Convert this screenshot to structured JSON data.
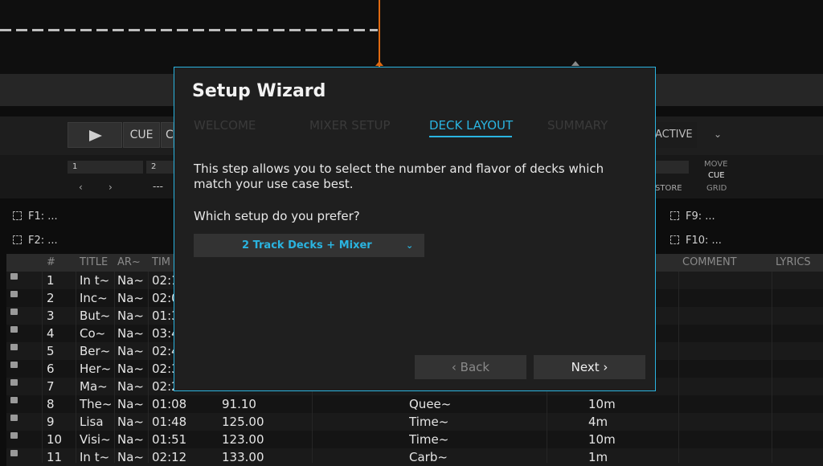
{
  "deck": {
    "cue_label": "CUE",
    "cue_b_label": "C",
    "active_label": "ACTIVE",
    "loop_cells": [
      "1",
      "2"
    ],
    "arrow_left": "‹",
    "arrow_right": "›",
    "dots": "---",
    "store_label": "STORE",
    "move_label": "MOVE",
    "cue_mode_label": "CUE",
    "grid_label": "GRID"
  },
  "favorites": [
    "F1: ...",
    "F2: ...",
    "F9: ...",
    "F10: ..."
  ],
  "table": {
    "headers": {
      "num": "#",
      "title": "TITLE",
      "artist": "AR~",
      "time": "TIM",
      "comment": "COMMENT",
      "lyrics": "LYRICS"
    },
    "rows": [
      {
        "num": "1",
        "title": "In t~",
        "artist": "Na~",
        "time": "02:1",
        "bpm": "",
        "album": "",
        "key": ""
      },
      {
        "num": "2",
        "title": "Inc~",
        "artist": "Na~",
        "time": "02:0",
        "bpm": "",
        "album": "",
        "key": ""
      },
      {
        "num": "3",
        "title": "But~",
        "artist": "Na~",
        "time": "01:3",
        "bpm": "",
        "album": "",
        "key": ""
      },
      {
        "num": "4",
        "title": "Co~",
        "artist": "Na~",
        "time": "03:4",
        "bpm": "",
        "album": "",
        "key": ""
      },
      {
        "num": "5",
        "title": "Ber~",
        "artist": "Na~",
        "time": "02:4",
        "bpm": "",
        "album": "",
        "key": ""
      },
      {
        "num": "6",
        "title": "Her~",
        "artist": "Na~",
        "time": "02:3",
        "bpm": "",
        "album": "",
        "key": ""
      },
      {
        "num": "7",
        "title": "Ma~",
        "artist": "Na~",
        "time": "02:2",
        "bpm": "",
        "album": "",
        "key": ""
      },
      {
        "num": "8",
        "title": "The~",
        "artist": "Na~",
        "time": "01:08",
        "bpm": "91.10",
        "album": "Quee~",
        "key": "10m"
      },
      {
        "num": "9",
        "title": "Lisa",
        "artist": "Na~",
        "time": "01:48",
        "bpm": "125.00",
        "album": "Time~",
        "key": "4m"
      },
      {
        "num": "10",
        "title": "Visi~",
        "artist": "Na~",
        "time": "01:51",
        "bpm": "123.00",
        "album": "Time~",
        "key": "10m"
      },
      {
        "num": "11",
        "title": "In t~",
        "artist": "Na~",
        "time": "02:12",
        "bpm": "133.00",
        "album": "Carb~",
        "key": "1m"
      }
    ]
  },
  "wizard": {
    "title": "Setup Wizard",
    "steps": [
      "WELCOME",
      "MIXER SETUP",
      "DECK LAYOUT",
      "SUMMARY"
    ],
    "current_step": "DECK LAYOUT",
    "description": "This step allows you to select the number and flavor of decks which match your use case best.",
    "question": "Which setup do you prefer?",
    "select_value": "2 Track Decks + Mixer",
    "back_label": "‹ Back",
    "next_label": "Next ›"
  },
  "colors": {
    "accent": "#2ab4e0",
    "playhead": "#e06a12"
  }
}
